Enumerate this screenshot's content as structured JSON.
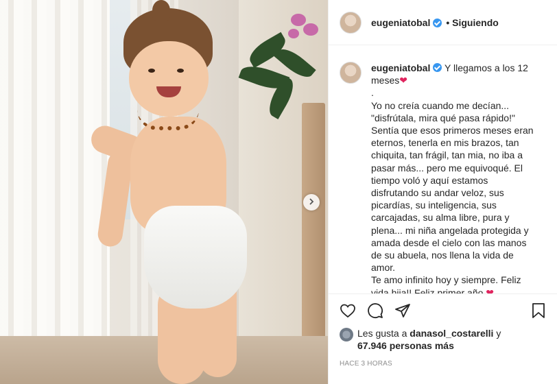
{
  "post": {
    "username": "eugeniatobal",
    "follow_status": "• Siguiendo",
    "caption_lines": [
      "Y llegamos a los 12",
      "meses",
      ".",
      "Yo no creía cuando me decían...",
      "\"disfrútala, mira qué pasa rápido!\"",
      "Sentía que esos primeros meses eran",
      "eternos, tenerla en mis brazos, tan",
      "chiquita, tan frágil, tan mia, no iba a",
      "pasar más... pero me equivoqué. El",
      "tiempo voló y aquí estamos",
      "disfrutando su andar veloz, sus",
      "picardías, su inteligencia, sus",
      "carcajadas, su alma libre, pura y",
      "plena... mi niña angelada protegida y",
      "amada desde el cielo con las manos",
      "de su abuela, nos llena la vida de",
      "amor.",
      "Te amo infinito hoy y siempre. Feliz",
      "vida hija!! Feliz primer año"
    ],
    "heart_emoji": "❤",
    "likes_prefix": "Les gusta a ",
    "likes_user": "danasol_costarelli",
    "likes_y": " y",
    "likes_count": "67.946 personas más",
    "time": "HACE 3 HORAS"
  },
  "icons": {
    "like": "heart-outline-icon",
    "comment": "comment-icon",
    "share": "send-icon",
    "save": "bookmark-icon",
    "next": "chevron-right-icon",
    "verified": "verified-badge-icon"
  },
  "colors": {
    "verified": "#3897f0",
    "heart": "#e0245e",
    "muted": "#8e8e8e"
  }
}
